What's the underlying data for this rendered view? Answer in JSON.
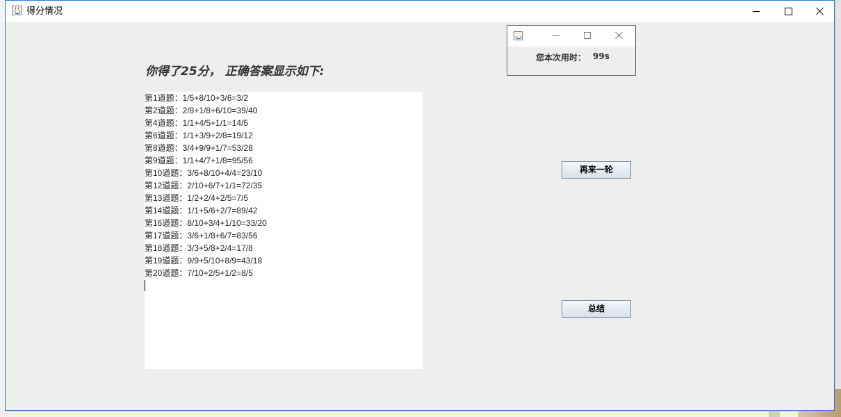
{
  "window": {
    "title": "得分情况",
    "controls": [
      "minimize-icon",
      "maximize-icon",
      "close-icon"
    ]
  },
  "headline": "你得了25分， 正确答案显示如下:",
  "answers": [
    "第1道题：1/5+8/10+3/6=3/2",
    "第2道题：2/8+1/8+6/10=39/40",
    "第4道题：1/1+4/5+1/1=14/5",
    "第6道题：1/1+3/9+2/8=19/12",
    "第8道题：3/4+9/9+1/7=53/28",
    "第9道题：1/1+4/7+1/8=95/56",
    "第10道题：3/6+8/10+4/4=23/10",
    "第12道题：2/10+6/7+1/1=72/35",
    "第13道题：1/2+2/4+2/5=7/5",
    "第14道题：1/1+5/6+2/7=89/42",
    "第16道题：8/10+3/4+1/10=33/20",
    "第17道题：3/6+1/8+6/7=83/56",
    "第18道题：3/3+5/8+2/4=17/8",
    "第19道题：9/9+5/10+8/9=43/18",
    "第20道题：7/10+2/5+1/2=8/5"
  ],
  "buttons": {
    "again": "再来一轮",
    "summary": "总结"
  },
  "timer": {
    "label": "您本次用时：",
    "value": "99s"
  }
}
